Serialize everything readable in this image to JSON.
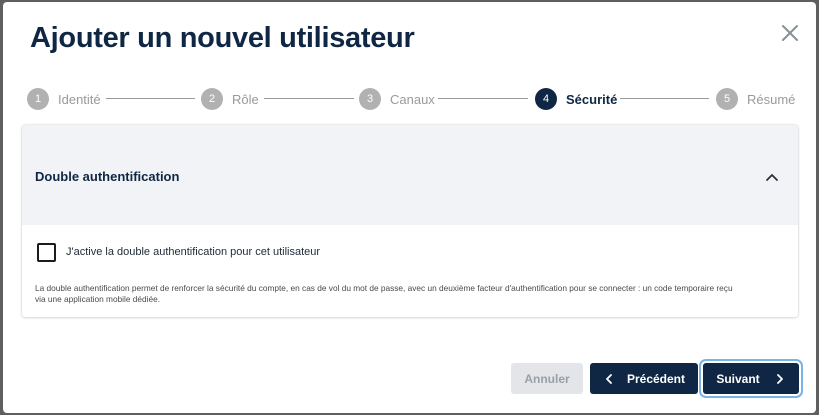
{
  "dialog": {
    "title": "Ajouter un nouvel utilisateur",
    "close_icon": "close-icon"
  },
  "stepper": {
    "current_step": 4,
    "steps": [
      {
        "number": "1",
        "label": "Identité"
      },
      {
        "number": "2",
        "label": "Rôle"
      },
      {
        "number": "3",
        "label": "Canaux"
      },
      {
        "number": "4",
        "label": "Sécurité"
      },
      {
        "number": "5",
        "label": "Résumé"
      }
    ]
  },
  "section": {
    "title": "Double authentification",
    "toggle_icon": "chevron-up-icon",
    "expanded": true,
    "checkbox": {
      "label": "J'active la double authentification pour cet utilisateur",
      "checked": false
    },
    "help_text": "La double authentification permet de renforcer la sécurité du compte, en cas de vol du mot de passe, avec un deuxième facteur d'authentification pour se connecter : un code temporaire reçu via une application mobile dédiée."
  },
  "footer": {
    "cancel_label": "Annuler",
    "prev_label": "Précédent",
    "next_label": "Suivant"
  },
  "colors": {
    "primary": "#0f2744",
    "step_inactive": "#b1b1b1",
    "section_header_bg": "#f1f3f6",
    "focus_ring": "#7ab3e8",
    "disabled_bg": "#e3e5e8"
  }
}
